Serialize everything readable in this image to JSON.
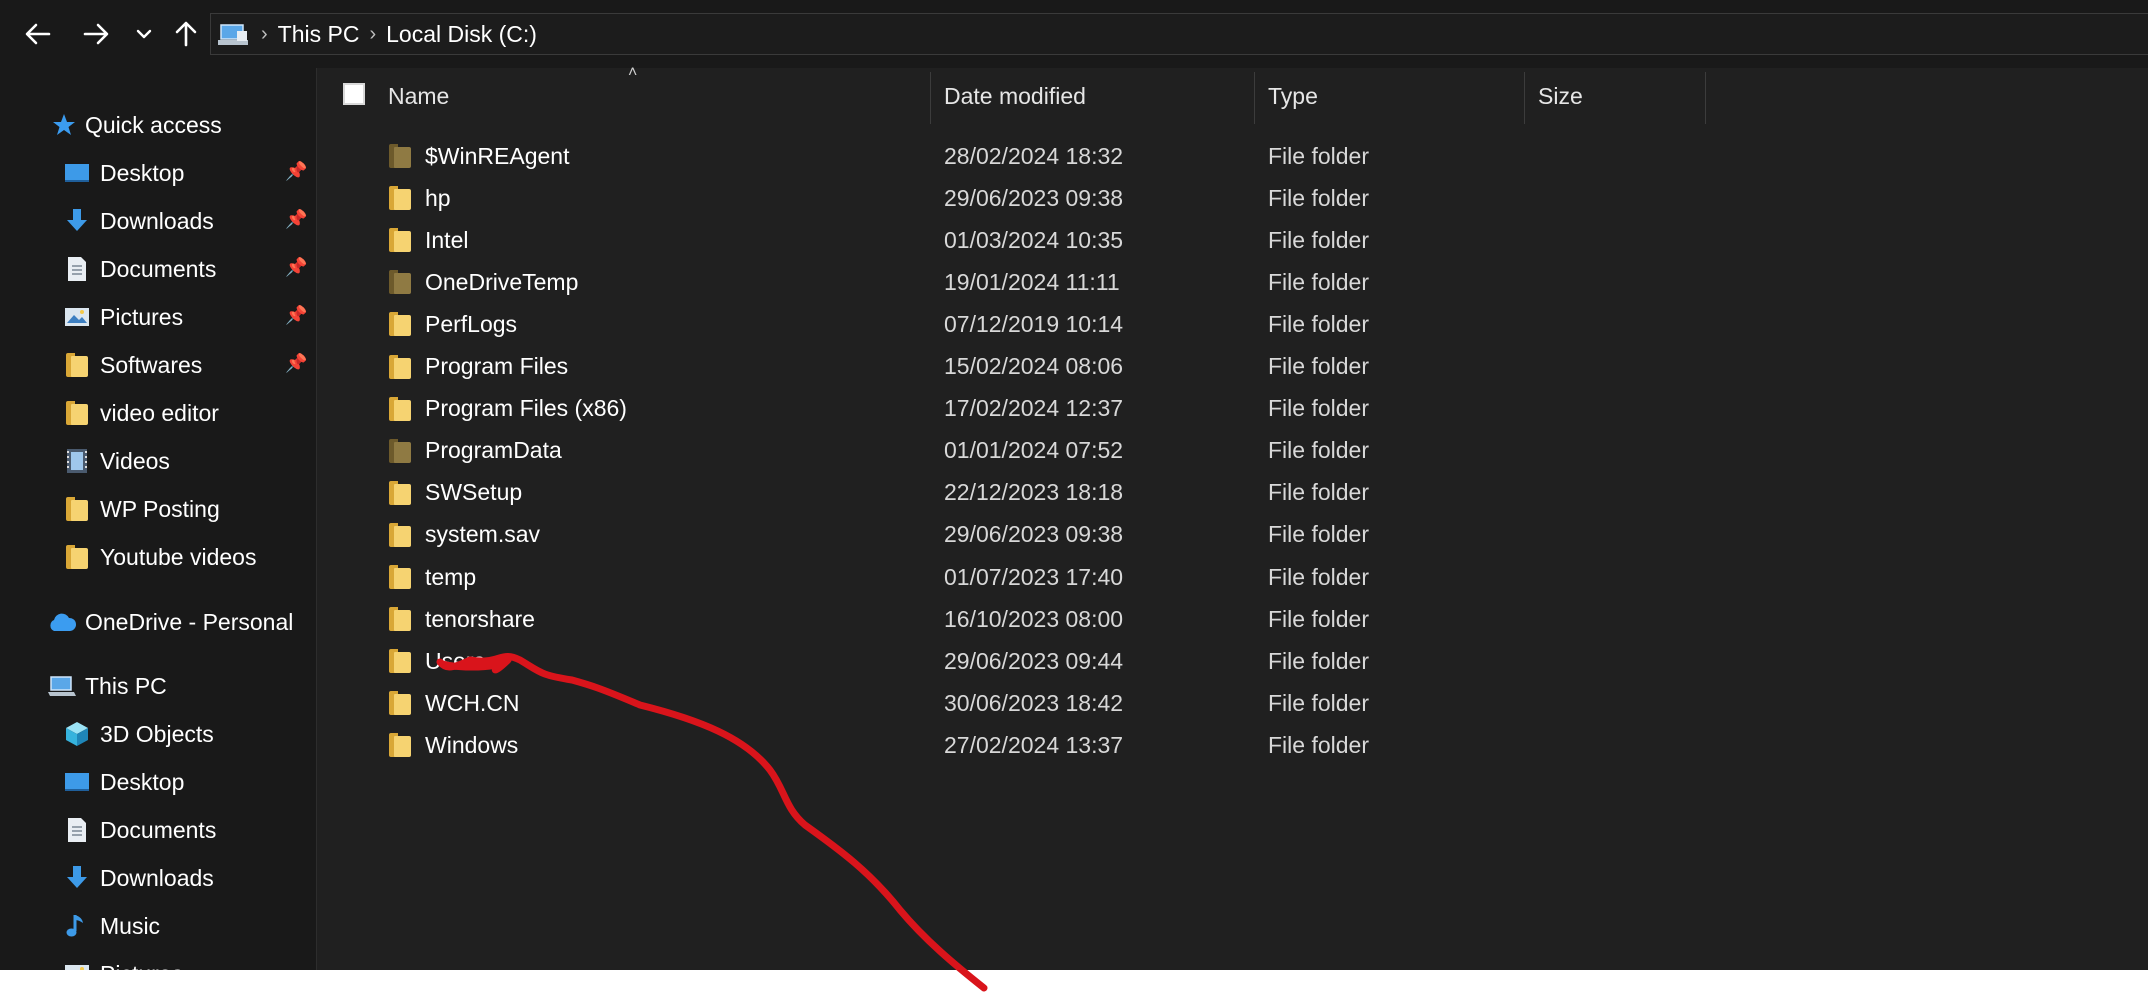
{
  "address_bar": {
    "breadcrumbs": [
      "This PC",
      "Local Disk (C:)"
    ]
  },
  "sidebar": {
    "quick_access": {
      "label": "Quick access",
      "items": [
        {
          "label": "Desktop",
          "icon": "desktop-icon",
          "pinned": true
        },
        {
          "label": "Downloads",
          "icon": "download-icon",
          "pinned": true
        },
        {
          "label": "Documents",
          "icon": "document-icon",
          "pinned": true
        },
        {
          "label": "Pictures",
          "icon": "pictures-icon",
          "pinned": true
        },
        {
          "label": "Softwares",
          "icon": "folder-icon",
          "pinned": true
        },
        {
          "label": "video editor",
          "icon": "folder-icon",
          "pinned": false
        },
        {
          "label": "Videos",
          "icon": "videos-icon",
          "pinned": false
        },
        {
          "label": "WP Posting",
          "icon": "folder-icon",
          "pinned": false
        },
        {
          "label": "Youtube videos",
          "icon": "folder-icon",
          "pinned": false
        }
      ]
    },
    "onedrive": {
      "label": "OneDrive - Personal"
    },
    "this_pc": {
      "label": "This PC",
      "items": [
        {
          "label": "3D Objects",
          "icon": "3d-objects-icon"
        },
        {
          "label": "Desktop",
          "icon": "desktop-icon"
        },
        {
          "label": "Documents",
          "icon": "document-icon"
        },
        {
          "label": "Downloads",
          "icon": "download-icon"
        },
        {
          "label": "Music",
          "icon": "music-icon"
        },
        {
          "label": "Pictures",
          "icon": "pictures-icon"
        }
      ]
    }
  },
  "columns": {
    "name": "Name",
    "date_modified": "Date modified",
    "type": "Type",
    "size": "Size"
  },
  "files": [
    {
      "name": "$WinREAgent",
      "date": "28/02/2024 18:32",
      "type": "File folder",
      "hidden": true
    },
    {
      "name": "hp",
      "date": "29/06/2023 09:38",
      "type": "File folder",
      "hidden": false
    },
    {
      "name": "Intel",
      "date": "01/03/2024 10:35",
      "type": "File folder",
      "hidden": false
    },
    {
      "name": "OneDriveTemp",
      "date": "19/01/2024 11:11",
      "type": "File folder",
      "hidden": true
    },
    {
      "name": "PerfLogs",
      "date": "07/12/2019 10:14",
      "type": "File folder",
      "hidden": false
    },
    {
      "name": "Program Files",
      "date": "15/02/2024 08:06",
      "type": "File folder",
      "hidden": false
    },
    {
      "name": "Program Files (x86)",
      "date": "17/02/2024 12:37",
      "type": "File folder",
      "hidden": false
    },
    {
      "name": "ProgramData",
      "date": "01/01/2024 07:52",
      "type": "File folder",
      "hidden": true
    },
    {
      "name": "SWSetup",
      "date": "22/12/2023 18:18",
      "type": "File folder",
      "hidden": false
    },
    {
      "name": "system.sav",
      "date": "29/06/2023 09:38",
      "type": "File folder",
      "hidden": false
    },
    {
      "name": "temp",
      "date": "01/07/2023 17:40",
      "type": "File folder",
      "hidden": false
    },
    {
      "name": "tenorshare",
      "date": "16/10/2023 08:00",
      "type": "File folder",
      "hidden": false
    },
    {
      "name": "Users",
      "date": "29/06/2023 09:44",
      "type": "File folder",
      "hidden": false
    },
    {
      "name": "WCH.CN",
      "date": "30/06/2023 18:42",
      "type": "File folder",
      "hidden": false
    },
    {
      "name": "Windows",
      "date": "27/02/2024 13:37",
      "type": "File folder",
      "hidden": false
    }
  ],
  "annotation": {
    "color": "#d9141b",
    "points_to": "Users"
  },
  "colors": {
    "background": "#202020",
    "sidebar": "#191919",
    "accent": "#3b9cf0"
  }
}
